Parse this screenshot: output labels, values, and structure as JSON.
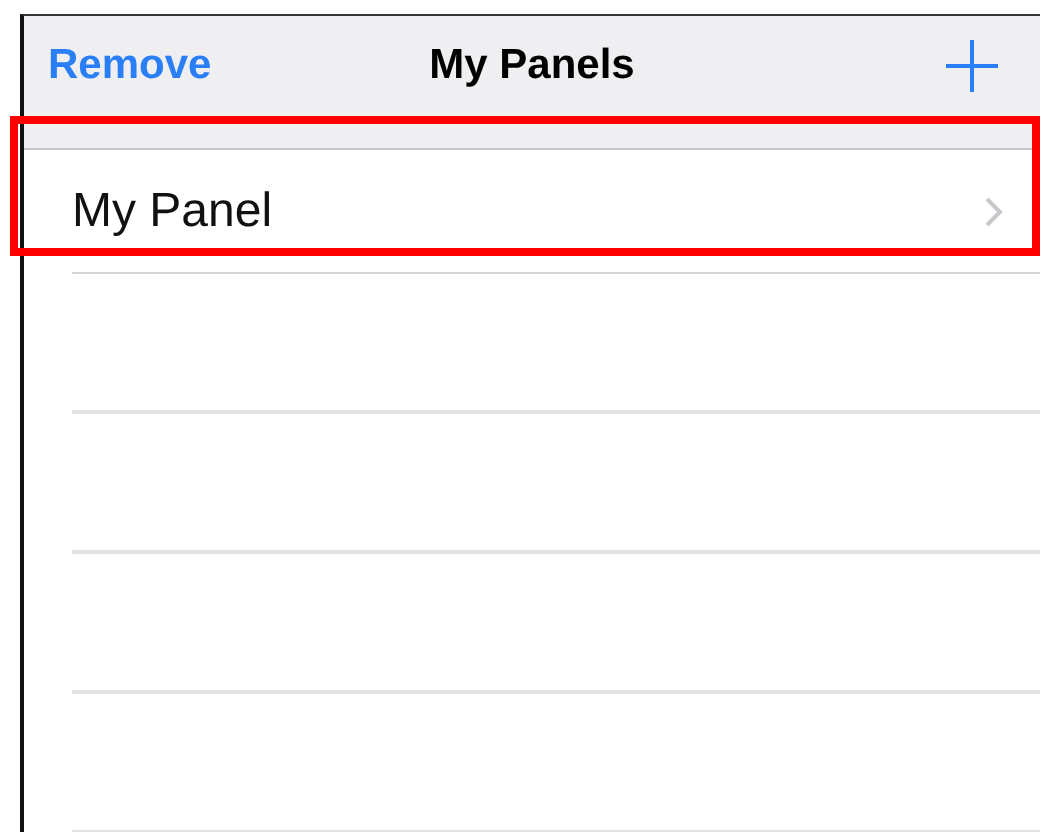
{
  "nav_bar": {
    "left_button": "Remove",
    "title": "My Panels"
  },
  "rows": [
    {
      "label": "My Panel",
      "highlighted": true
    }
  ]
}
